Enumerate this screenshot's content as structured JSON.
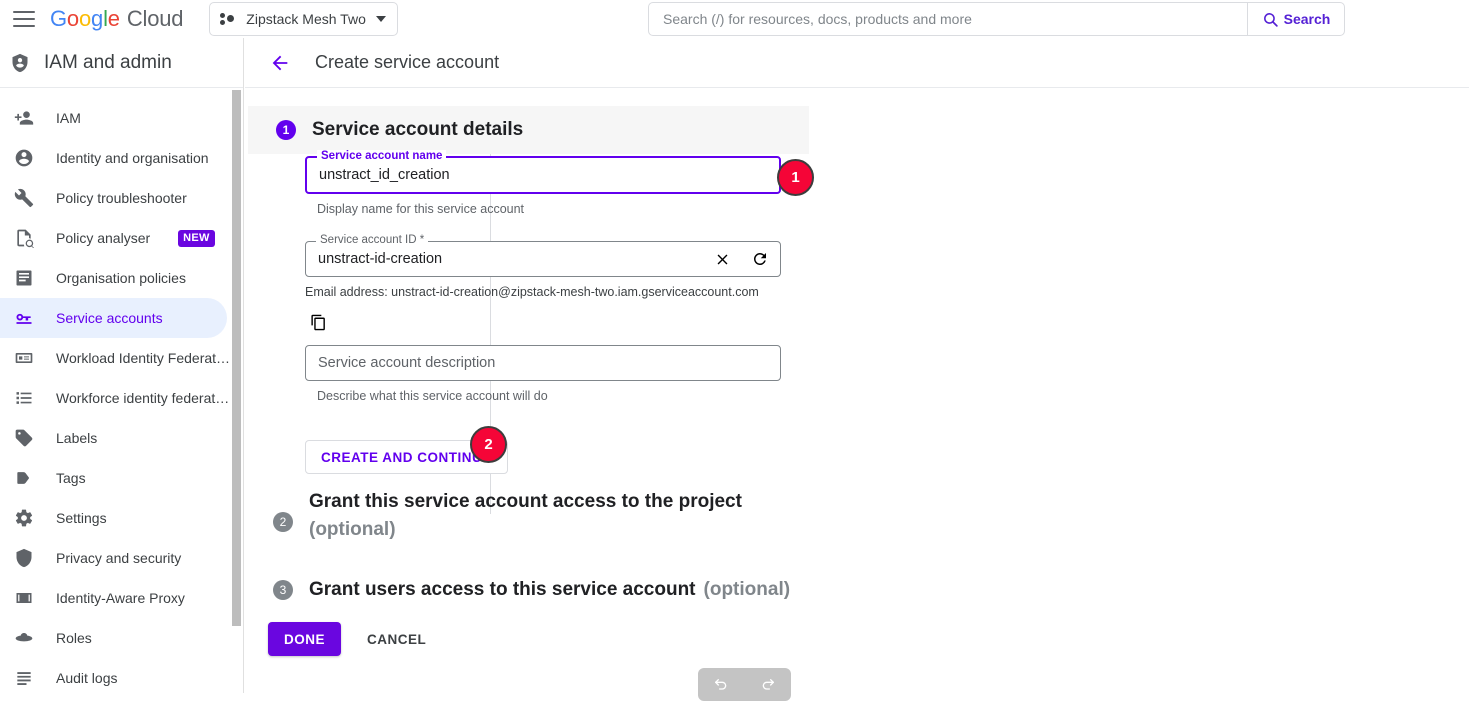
{
  "topbar": {
    "menu_icon": "hamburger-menu-icon",
    "logo": {
      "google": "Google",
      "cloud": "Cloud"
    },
    "project": {
      "name": "Zipstack Mesh Two",
      "icon": "project-dots-icon",
      "caret": "chevron-down-icon"
    },
    "search": {
      "placeholder": "Search (/) for resources, docs, products and more",
      "value": "",
      "button_label": "Search",
      "icon": "search-icon"
    }
  },
  "sidebar": {
    "header": {
      "title": "IAM and admin",
      "icon": "shield-person-icon"
    },
    "items": [
      {
        "label": "IAM",
        "icon": "person-add-icon",
        "active": false,
        "badge": ""
      },
      {
        "label": "Identity and organisation",
        "icon": "account-circle-icon",
        "active": false,
        "badge": ""
      },
      {
        "label": "Policy troubleshooter",
        "icon": "wrench-icon",
        "active": false,
        "badge": ""
      },
      {
        "label": "Policy analyser",
        "icon": "document-search-icon",
        "active": false,
        "badge": "NEW"
      },
      {
        "label": "Organisation policies",
        "icon": "list-document-icon",
        "active": false,
        "badge": ""
      },
      {
        "label": "Service accounts",
        "icon": "key-icon",
        "active": true,
        "badge": ""
      },
      {
        "label": "Workload Identity Federat…",
        "icon": "id-card-icon",
        "active": false,
        "badge": ""
      },
      {
        "label": "Workforce identity federat…",
        "icon": "list-bullet-icon",
        "active": false,
        "badge": ""
      },
      {
        "label": "Labels",
        "icon": "label-tag-icon",
        "active": false,
        "badge": ""
      },
      {
        "label": "Tags",
        "icon": "tag-arrow-icon",
        "active": false,
        "badge": ""
      },
      {
        "label": "Settings",
        "icon": "gear-icon",
        "active": false,
        "badge": ""
      },
      {
        "label": "Privacy and security",
        "icon": "shield-icon",
        "active": false,
        "badge": ""
      },
      {
        "label": "Identity-Aware Proxy",
        "icon": "proxy-icon",
        "active": false,
        "badge": ""
      },
      {
        "label": "Roles",
        "icon": "roles-hat-icon",
        "active": false,
        "badge": ""
      },
      {
        "label": "Audit logs",
        "icon": "audit-lines-icon",
        "active": false,
        "badge": ""
      }
    ]
  },
  "main": {
    "back_icon": "back-arrow-icon",
    "page_title": "Create service account",
    "step1": {
      "number": "1",
      "title": "Service account details",
      "name_field": {
        "legend": "Service account name",
        "value": "unstract_id_creation",
        "hint": "Display name for this service account"
      },
      "id_field": {
        "legend": "Service account ID *",
        "value": "unstract-id-creation",
        "clear_icon": "close-icon",
        "refresh_icon": "refresh-icon"
      },
      "email_line": "Email address: unstract-id-creation@zipstack-mesh-two.iam.gserviceaccount.com",
      "copy_icon": "copy-icon",
      "desc_field": {
        "placeholder": "Service account description",
        "value": "",
        "hint": "Describe what this service account will do"
      },
      "create_button": "CREATE AND CONTINUE"
    },
    "step2": {
      "number": "2",
      "title": "Grant this service account access to the project",
      "optional": "(optional)"
    },
    "step3": {
      "number": "3",
      "title": "Grant users access to this service account",
      "optional": "(optional)"
    },
    "footer": {
      "done": "DONE",
      "cancel": "CANCEL"
    },
    "floating_toolbar": {
      "undo_icon": "undo-icon",
      "redo_icon": "redo-icon"
    }
  },
  "annotations": [
    {
      "id": "1",
      "target": "service-account-name-field"
    },
    {
      "id": "2",
      "target": "create-and-continue-button"
    }
  ],
  "colors": {
    "accent_purple": "#6200ee",
    "marker_red": "#f50537",
    "active_nav_bg": "#e8f0fe",
    "banner_grey": "#f6f6f6"
  }
}
